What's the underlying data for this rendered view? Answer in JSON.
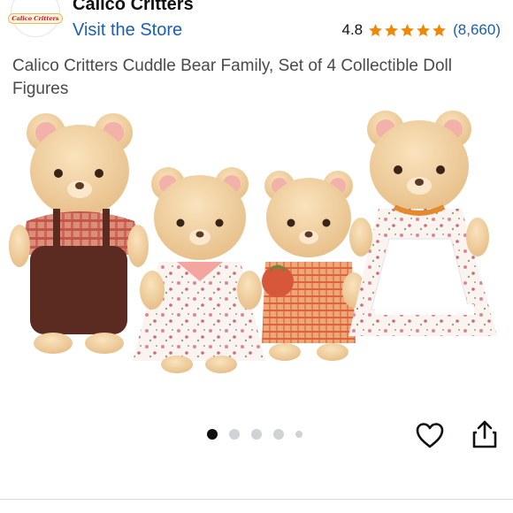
{
  "header": {
    "brand_logo_text": "Calico Critters",
    "brand_name": "Calico Critters",
    "visit_store": "Visit the Store",
    "rating_value": "4.8",
    "rating_stars": 4.8,
    "rating_count": "(8,660)",
    "star_color": "#f08804"
  },
  "product": {
    "title": "Calico Critters Cuddle Bear Family, Set of 4 Collectible Doll Figures"
  },
  "gallery": {
    "image_count": 5,
    "active_index": 0
  },
  "actions": {
    "wishlist_icon": "heart-icon",
    "share_icon": "share-icon"
  },
  "colors": {
    "link": "#1a5fb4",
    "active_dot": "#0f1111",
    "inactive_dot": "#cfd3d6"
  }
}
